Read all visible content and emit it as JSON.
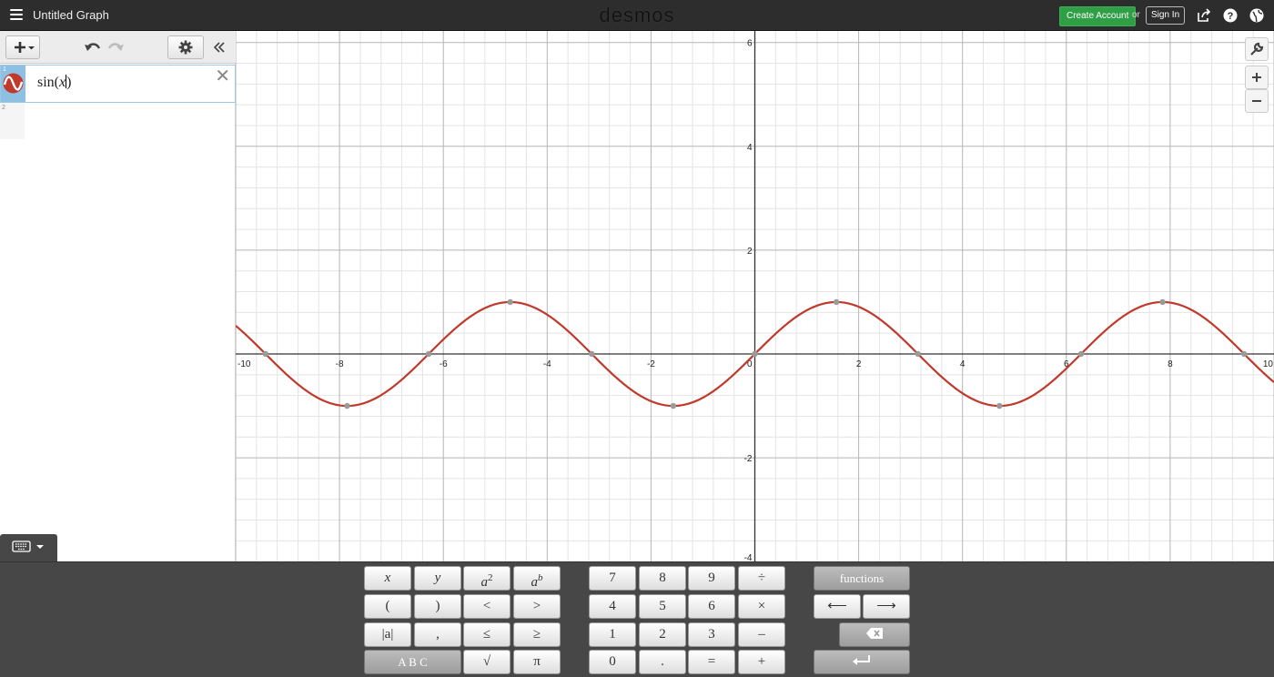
{
  "app": {
    "title": "Untitled Graph",
    "brand": "desmos",
    "create_account_label": "Create Account",
    "or_label": "or",
    "sign_in_label": "Sign In"
  },
  "expressions": [
    {
      "index": "1",
      "func": "sin(",
      "var": "x",
      "close": ")",
      "color": "#c0392b"
    },
    {
      "index": "2"
    }
  ],
  "graph": {
    "x_range": [
      -10,
      10
    ],
    "y_range": [
      -4,
      6
    ],
    "x_tick_labels": [
      "-10",
      "-8",
      "-6",
      "-4",
      "-2",
      "0",
      "2",
      "4",
      "6",
      "8",
      "10"
    ],
    "y_tick_labels": [
      "-4",
      "-2",
      "2",
      "4",
      "6"
    ],
    "curve_color": "#c0392b",
    "function": "sin(x)"
  },
  "keypad": {
    "var_keys": {
      "x": "x",
      "y": "y",
      "a": "a",
      "sq_exp": "2",
      "b_exp": "b",
      "lparen": "(",
      "rparen": ")",
      "lt": "<",
      "gt": ">",
      "abs": "|a|",
      "comma": ",",
      "le": "≤",
      "ge": "≥",
      "abc": "A B C",
      "sqrt": "√",
      "pi": "π"
    },
    "num_keys": {
      "k7": "7",
      "k8": "8",
      "k9": "9",
      "div": "÷",
      "k4": "4",
      "k5": "5",
      "k6": "6",
      "mul": "×",
      "k1": "1",
      "k2": "2",
      "k3": "3",
      "minus": "–",
      "k0": "0",
      "dot": ".",
      "eq": "=",
      "plus": "+"
    },
    "func_keys": {
      "functions": "functions",
      "left": "⟵",
      "right": "⟶"
    }
  }
}
